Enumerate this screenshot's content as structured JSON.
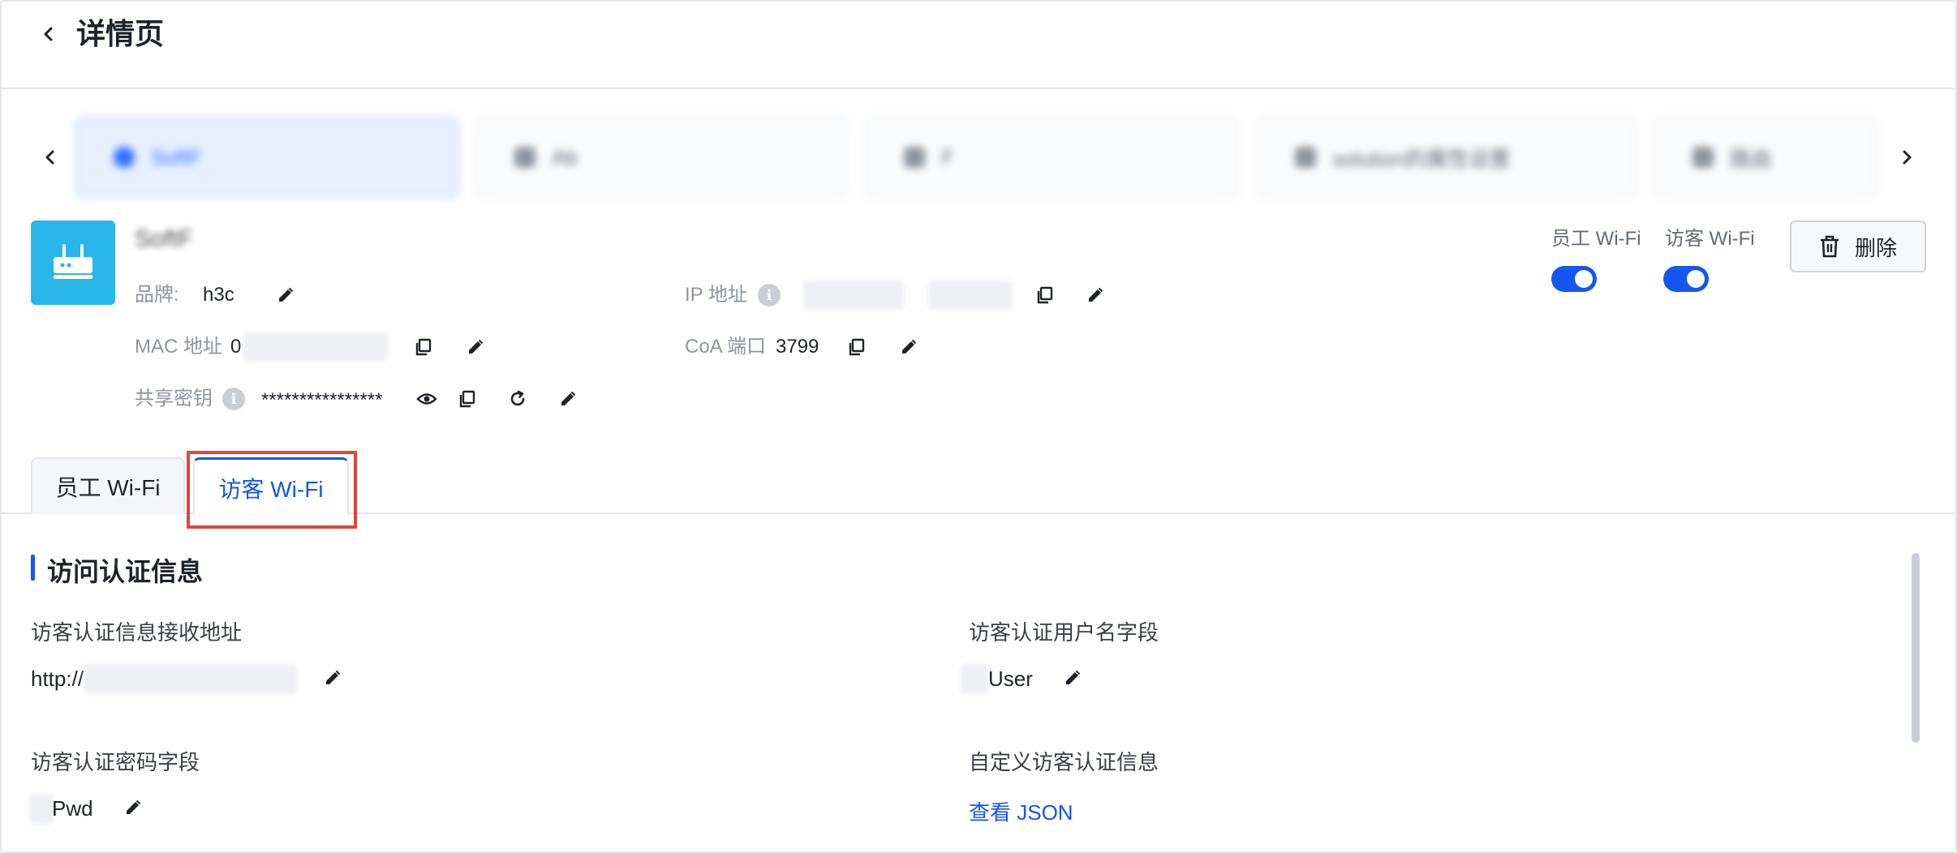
{
  "header": {
    "title": "详情页"
  },
  "carousel": {
    "cards": [
      {
        "label": "SoftF"
      },
      {
        "label": "Ab"
      },
      {
        "label": "F"
      },
      {
        "label": "solution的属性设置"
      },
      {
        "label": "路由"
      }
    ]
  },
  "device": {
    "name": "SoftF",
    "brand_label": "品牌:",
    "brand_value": "h3c",
    "ip_label": "IP 地址",
    "mac_label": "MAC 地址",
    "mac_prefix": "0",
    "coa_label": "CoA 端口",
    "coa_value": "3799",
    "secret_label": "共享密钥",
    "secret_value": "****************",
    "info_symbol": "i"
  },
  "toggles": [
    {
      "label": "员工 Wi-Fi",
      "state": "on"
    },
    {
      "label": "访客 Wi-Fi",
      "state": "on"
    }
  ],
  "delete_button": {
    "label": "删除"
  },
  "tabs": [
    {
      "label": "员工 Wi-Fi",
      "active": false
    },
    {
      "label": "访客 Wi-Fi",
      "active": true
    }
  ],
  "section": {
    "title": "访问认证信息",
    "fields": {
      "receive_url_label": "访客认证信息接收地址",
      "receive_url_value": "http://",
      "username_field_label": "访客认证用户名字段",
      "username_field_value": "User",
      "password_field_label": "访客认证密码字段",
      "password_field_value": "Pwd",
      "custom_info_label": "自定义访客认证信息",
      "custom_info_link": "查看 JSON"
    }
  },
  "colors": {
    "accent": "#1456f0",
    "device_icon_bg": "#29b6e8",
    "highlight": "#e0453a"
  }
}
